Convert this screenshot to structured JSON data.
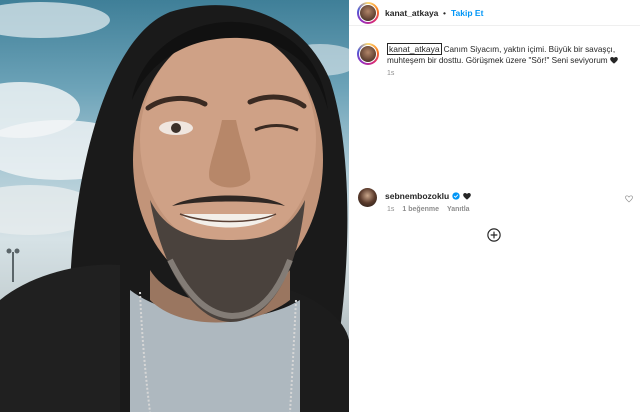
{
  "post": {
    "username": "kanat_atkaya",
    "follow_label": "Takip Et",
    "separator": "•",
    "caption_text": "Canım Siyacım, yaktın içimi. Büyük bir savaşçı, muhteşem bir dosttu. Görüşmek üzere \"Sör!\" Seni seviyorum",
    "caption_time": "1s"
  },
  "comments": [
    {
      "username": "sebnembozoklu",
      "verified": true,
      "text_icon": "black-heart-icon",
      "time": "1s",
      "likes_label": "1 beğenme",
      "reply_label": "Yanıtla"
    }
  ],
  "icons": {
    "like": "heart-outline-icon",
    "load_more": "plus-circle-icon",
    "verified": "verified-badge-icon"
  },
  "colors": {
    "link_blue": "#0095f6",
    "muted_text": "#8e8e8e",
    "verified_blue": "#0095f6",
    "primary_text": "#262626"
  }
}
